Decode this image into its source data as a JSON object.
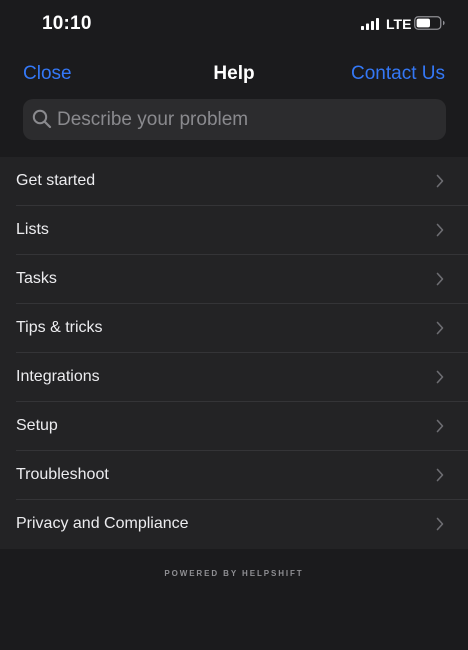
{
  "status_bar": {
    "time": "10:10",
    "network": "LTE",
    "signal_icon": "cellular-signal-icon",
    "battery_icon": "battery-icon",
    "battery_level": 0.6
  },
  "nav": {
    "close_label": "Close",
    "title": "Help",
    "contact_label": "Contact Us"
  },
  "search": {
    "placeholder": "Describe your problem",
    "value": "",
    "icon": "search-icon"
  },
  "help_items": [
    {
      "label": "Get started"
    },
    {
      "label": "Lists"
    },
    {
      "label": "Tasks"
    },
    {
      "label": "Tips & tricks"
    },
    {
      "label": "Integrations"
    },
    {
      "label": "Setup"
    },
    {
      "label": "Troubleshoot"
    },
    {
      "label": "Privacy and Compliance"
    }
  ],
  "footer": {
    "powered_by": "POWERED BY HELPSHIFT"
  },
  "colors": {
    "background": "#1b1b1d",
    "list_background": "#232325",
    "accent": "#3478f6",
    "search_background": "#2c2c2e",
    "separator": "#343437"
  }
}
